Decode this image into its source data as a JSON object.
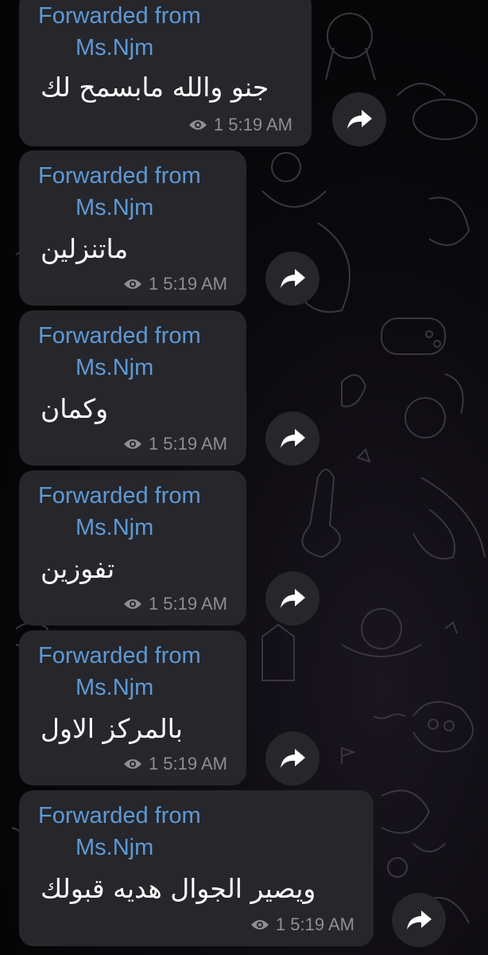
{
  "messages": [
    {
      "forwarded_label": "Forwarded from",
      "sender": "Ms.Njm",
      "text": "جنو والله مابسمح لك",
      "views_icon": "eye-icon",
      "time": "1 5:19 AM"
    },
    {
      "forwarded_label": "Forwarded from",
      "sender": "Ms.Njm",
      "text": "ماتنزلين",
      "views_icon": "eye-icon",
      "time": "1 5:19 AM"
    },
    {
      "forwarded_label": "Forwarded from",
      "sender": "Ms.Njm",
      "text": "وكمان",
      "views_icon": "eye-icon",
      "time": "1 5:19 AM"
    },
    {
      "forwarded_label": "Forwarded from",
      "sender": "Ms.Njm",
      "text": "تفوزين",
      "views_icon": "eye-icon",
      "time": "1 5:19 AM"
    },
    {
      "forwarded_label": "Forwarded from",
      "sender": "Ms.Njm",
      "text": "بالمركز الاول",
      "views_icon": "eye-icon",
      "time": "1 5:19 AM"
    },
    {
      "forwarded_label": "Forwarded from",
      "sender": "Ms.Njm",
      "text": "ويصير الجوال هديه قبولك",
      "views_icon": "eye-icon",
      "time": "1 5:19 AM"
    }
  ],
  "share_button_icon": "share-arrow-icon",
  "colors": {
    "bubble": "#26262b",
    "link": "#5d9ad6",
    "text": "#ffffff",
    "meta": "#8e8e93",
    "background": "#050506"
  }
}
